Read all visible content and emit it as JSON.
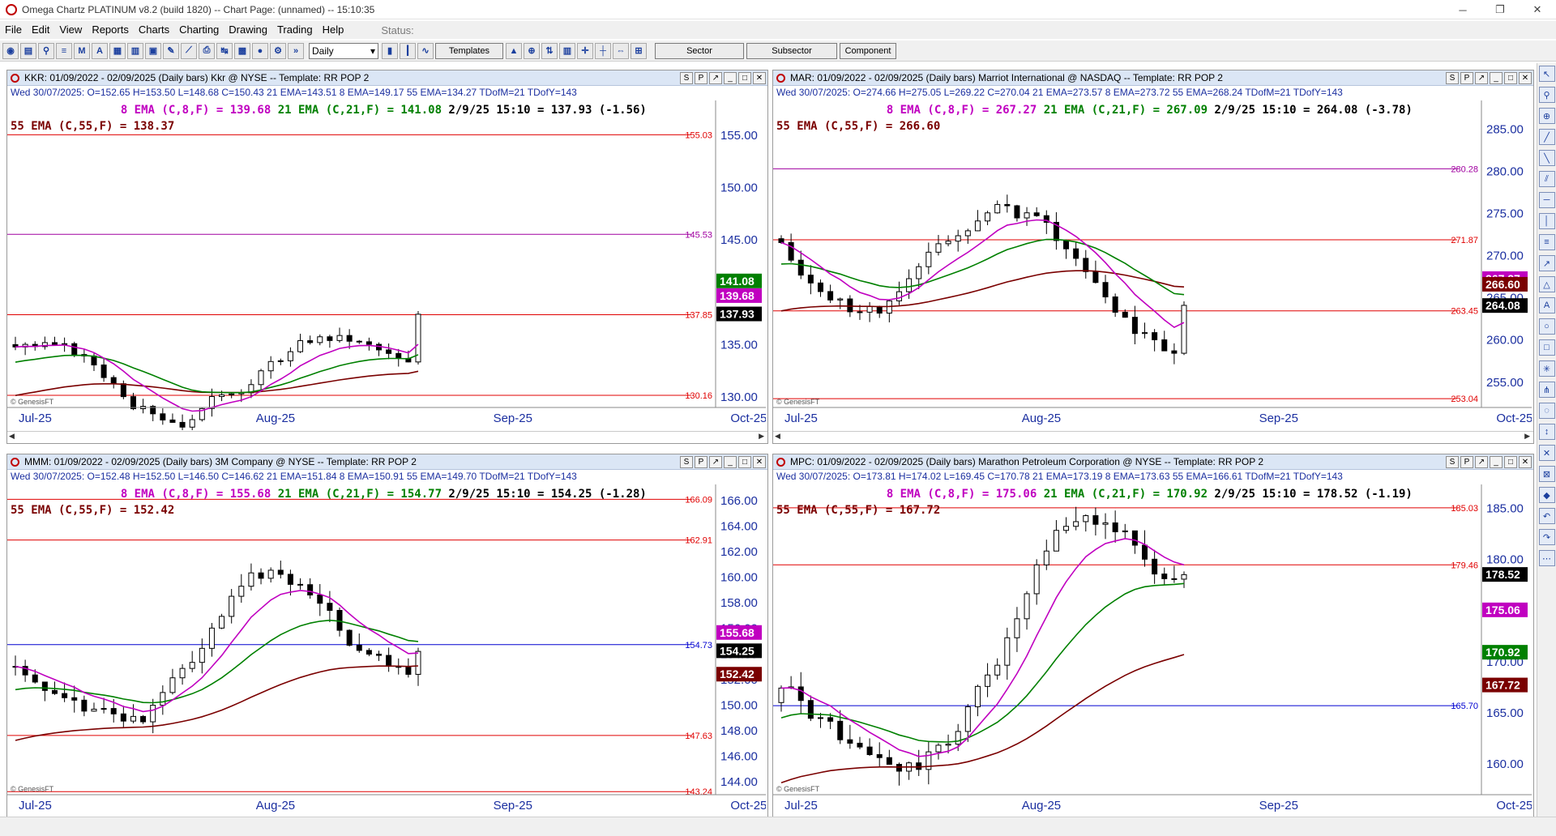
{
  "window": {
    "title": "Omega Chartz PLATINUM v8.2 (build 1820)  --  Chart Page: (unnamed)  --  15:10:35"
  },
  "menu": [
    "File",
    "Edit",
    "View",
    "Reports",
    "Charts",
    "Charting",
    "Drawing",
    "Trading",
    "Help"
  ],
  "status_label": "Status:",
  "toolbar": {
    "interval": "Daily",
    "templates_label": "Templates",
    "sector_label": "Sector",
    "subsector_label": "Subsector",
    "component_label": "Component"
  },
  "watermark": "© GenesisFT",
  "panels": [
    {
      "header": "KKR: 01/09/2022 - 02/09/2025  (Daily bars)   Kkr @ NYSE  --  Template: RR POP 2",
      "quote": "Wed  30/07/2025:  O=152.65  H=153.50  L=148.68  C=150.43  21 EMA=143.51  8 EMA=149.17  55 EMA=134.27  TDofM=21  TDofY=143",
      "ema8": "8 EMA (C,8,F) = 139.68",
      "ema21": "21 EMA (C,21,F) = 141.08",
      "last": "2/9/25 15:10 = 137.93 (-1.56)",
      "ema55": "55 EMA (C,55,F) = 138.37",
      "yticks": [
        "155.00",
        "150.00",
        "145.00",
        "140.00",
        "135.00",
        "130.00"
      ],
      "ylim": [
        129,
        158
      ],
      "xticks": [
        "Jul-25",
        "Aug-25",
        "Sep-25",
        "Oct-25"
      ],
      "lines": [
        {
          "v": 155.03,
          "label": "155.03",
          "color": "#e00000"
        },
        {
          "v": 145.53,
          "label": "145.53",
          "color": "#a000a0"
        },
        {
          "v": 137.85,
          "label": "137.85",
          "color": "#e00000"
        },
        {
          "v": 130.16,
          "label": "130.16",
          "color": "#e00000"
        }
      ],
      "badges": [
        {
          "v": 141.08,
          "label": "141.08",
          "bg": "#008000"
        },
        {
          "v": 139.68,
          "label": "139.68",
          "bg": "#c000c0"
        },
        {
          "v": 137.93,
          "label": "137.93",
          "bg": "#000000"
        }
      ],
      "start": 135.0,
      "end": 137.9,
      "noise": 4.0,
      "seed": 3
    },
    {
      "header": "MAR: 01/09/2022 - 02/09/2025  (Daily bars)   Marriot International @ NASDAQ  --  Template: RR POP 2",
      "quote": "Wed  30/07/2025:  O=274.66  H=275.05  L=269.22  C=270.04  21 EMA=273.57  8 EMA=273.72  55 EMA=268.24  TDofM=21  TDofY=143",
      "ema8": "8 EMA (C,8,F) = 267.27",
      "ema21": "21 EMA (C,21,F) = 267.09",
      "last": "2/9/25 15:10 = 264.08 (-3.78)",
      "ema55": "55 EMA (C,55,F) = 266.60",
      "yticks": [
        "285.00",
        "280.00",
        "275.00",
        "270.00",
        "265.00",
        "260.00",
        "255.00"
      ],
      "ylim": [
        252,
        288
      ],
      "xticks": [
        "Jul-25",
        "Aug-25",
        "Sep-25",
        "Oct-25"
      ],
      "lines": [
        {
          "v": 280.28,
          "label": "280.28",
          "color": "#a000a0"
        },
        {
          "v": 271.87,
          "label": "271.87",
          "color": "#e00000"
        },
        {
          "v": 263.45,
          "label": "263.45",
          "color": "#e00000"
        },
        {
          "v": 253.04,
          "label": "253.04",
          "color": "#e00000"
        }
      ],
      "badges": [
        {
          "v": 267.27,
          "label": "267.27",
          "bg": "#c000c0"
        },
        {
          "v": 266.6,
          "label": "266.60",
          "bg": "#7a0000"
        },
        {
          "v": 264.08,
          "label": "264.08",
          "bg": "#000000"
        }
      ],
      "start": 272.0,
      "end": 264.1,
      "noise": 7.0,
      "seed": 11
    },
    {
      "header": "MMM: 01/09/2022 - 02/09/2025  (Daily bars)   3M Company @ NYSE  --  Template: RR POP 2",
      "quote": "Wed  30/07/2025:  O=152.48  H=152.50  L=146.50  C=146.62  21 EMA=151.84  8 EMA=150.91  55 EMA=149.70  TDofM=21  TDofY=143",
      "ema8": "8 EMA (C,8,F) = 155.68",
      "ema21": "21 EMA (C,21,F) = 154.77",
      "last": "2/9/25 15:10 = 154.25 (-1.28)",
      "ema55": "55 EMA (C,55,F) = 152.42",
      "yticks": [
        "166.00",
        "164.00",
        "162.00",
        "160.00",
        "158.00",
        "156.00",
        "154.00",
        "152.00",
        "150.00",
        "148.00",
        "146.00",
        "144.00"
      ],
      "ylim": [
        143,
        167
      ],
      "xticks": [
        "Jul-25",
        "Aug-25",
        "Sep-25",
        "Oct-25"
      ],
      "lines": [
        {
          "v": 166.09,
          "label": "166.09",
          "color": "#e00000"
        },
        {
          "v": 162.91,
          "label": "162.91",
          "color": "#e00000"
        },
        {
          "v": 154.73,
          "label": "154.73",
          "color": "#0000d0"
        },
        {
          "v": 147.63,
          "label": "147.63",
          "color": "#e00000"
        },
        {
          "v": 143.24,
          "label": "143.24",
          "color": "#e00000"
        }
      ],
      "badges": [
        {
          "v": 155.68,
          "label": "155.68",
          "bg": "#c000c0"
        },
        {
          "v": 154.25,
          "label": "154.25",
          "bg": "#000000"
        },
        {
          "v": 152.42,
          "label": "152.42",
          "bg": "#7a0000"
        }
      ],
      "start": 153.0,
      "end": 154.2,
      "noise": 5.0,
      "seed": 23
    },
    {
      "header": "MPC: 01/09/2022 - 02/09/2025  (Daily bars)   Marathon Petroleum Corporation @ NYSE  --  Template: RR POP 2",
      "quote": "Wed  30/07/2025:  O=173.81  H=174.02  L=169.45  C=170.78  21 EMA=173.19  8 EMA=173.63  55 EMA=166.61  TDofM=21  TDofY=143",
      "ema8": "8 EMA (C,8,F) = 175.06",
      "ema21": "21 EMA (C,21,F) = 170.92",
      "last": "2/9/25 15:10 = 178.52 (-1.19)",
      "ema55": "55 EMA (C,55,F) = 167.72",
      "yticks": [
        "185.00",
        "180.00",
        "175.00",
        "170.00",
        "165.00",
        "160.00"
      ],
      "ylim": [
        157,
        187
      ],
      "xticks": [
        "Jul-25",
        "Aug-25",
        "Sep-25",
        "Oct-25"
      ],
      "lines": [
        {
          "v": 185.03,
          "label": "185.03",
          "color": "#e00000"
        },
        {
          "v": 179.46,
          "label": "179.46",
          "color": "#e00000"
        },
        {
          "v": 165.7,
          "label": "165.70",
          "color": "#0000d0"
        }
      ],
      "badges": [
        {
          "v": 178.52,
          "label": "178.52",
          "bg": "#000000"
        },
        {
          "v": 175.06,
          "label": "175.06",
          "bg": "#c000c0"
        },
        {
          "v": 170.92,
          "label": "170.92",
          "bg": "#008000"
        },
        {
          "v": 167.72,
          "label": "167.72",
          "bg": "#7a0000"
        }
      ],
      "start": 166.0,
      "end": 178.5,
      "noise": 8.0,
      "seed": 41
    }
  ]
}
